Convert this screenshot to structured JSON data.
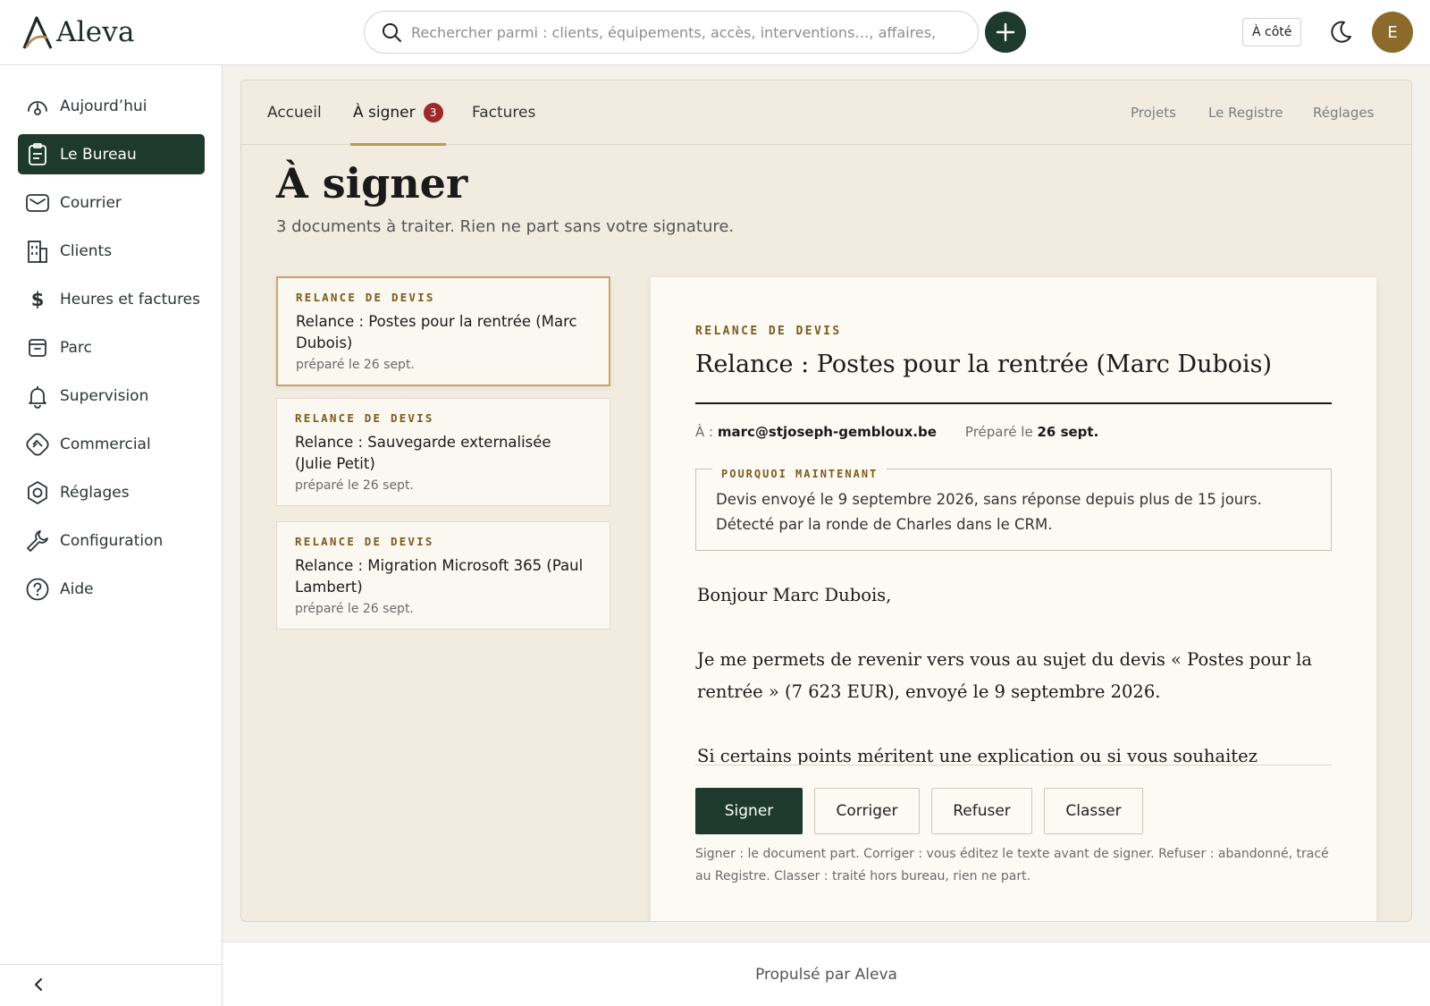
{
  "header": {
    "logo_text": "Aleva",
    "search_placeholder": "Rechercher parmi : clients, équipements, accès, interventions…, affaires,",
    "acote_label": "À côté",
    "avatar_initial": "E"
  },
  "sidebar": {
    "items": [
      {
        "label": "Aujourd’hui",
        "icon": "gauge-icon"
      },
      {
        "label": "Le Bureau",
        "icon": "clipboard-icon",
        "active": true
      },
      {
        "label": "Courrier",
        "icon": "mail-icon"
      },
      {
        "label": "Clients",
        "icon": "building-icon"
      },
      {
        "label": "Heures et factures",
        "icon": "dollar-icon"
      },
      {
        "label": "Parc",
        "icon": "archive-icon"
      },
      {
        "label": "Supervision",
        "icon": "bell-icon"
      },
      {
        "label": "Commercial",
        "icon": "handshake-icon"
      },
      {
        "label": "Réglages",
        "icon": "settings-icon"
      },
      {
        "label": "Configuration",
        "icon": "wrench-icon"
      },
      {
        "label": "Aide",
        "icon": "help-icon"
      }
    ]
  },
  "tabs": {
    "left": [
      {
        "label": "Accueil"
      },
      {
        "label": "À signer",
        "badge": "3",
        "active": true
      },
      {
        "label": "Factures"
      }
    ],
    "right": [
      {
        "label": "Projets"
      },
      {
        "label": "Le Registre"
      },
      {
        "label": "Réglages"
      }
    ]
  },
  "page": {
    "title": "À signer",
    "subtitle": "3 documents à traiter. Rien ne part sans votre signature."
  },
  "documents": [
    {
      "kicker": "RELANCE DE DEVIS",
      "title": "Relance : Postes pour la rentrée (Marc Dubois)",
      "date": "préparé le 26 sept."
    },
    {
      "kicker": "RELANCE DE DEVIS",
      "title": "Relance : Sauvegarde externalisée (Julie Petit)",
      "date": "préparé le 26 sept."
    },
    {
      "kicker": "RELANCE DE DEVIS",
      "title": "Relance : Migration Microsoft 365 (Paul Lambert)",
      "date": "préparé le 26 sept."
    }
  ],
  "detail": {
    "kicker": "RELANCE DE DEVIS",
    "title": "Relance : Postes pour la rentrée (Marc Dubois)",
    "to_label": "À :",
    "to_value": "marc@stjoseph-gembloux.be",
    "prepared_label": "Préparé le",
    "prepared_value": "26 sept.",
    "why_legend": "POURQUOI MAINTENANT",
    "why_text": "Devis envoyé le 9 septembre 2026, sans réponse depuis plus de 15 jours. Détecté par la ronde de Charles dans le CRM.",
    "letter": [
      "Bonjour Marc Dubois,",
      "Je me permets de revenir vers vous au sujet du devis « Postes pour la rentrée » (7 623 EUR), envoyé le 9 septembre 2026.",
      "Si certains points méritent une explication ou si vous souhaitez adapter"
    ],
    "actions": {
      "sign": "Signer",
      "correct": "Corriger",
      "refuse": "Refuser",
      "file": "Classer"
    },
    "help": "Signer : le document part. Corriger : vous éditez le texte avant de signer. Refuser : abandonné, tracé au Registre. Classer : traité hors bureau, rien ne part."
  },
  "footer": {
    "text": "Propulsé par Aleva"
  },
  "colors": {
    "brand_green": "#1e3a2e",
    "accent_gold": "#b89a5c",
    "kicker_brown": "#7b5b1e",
    "badge_red": "#9b2a2a"
  }
}
